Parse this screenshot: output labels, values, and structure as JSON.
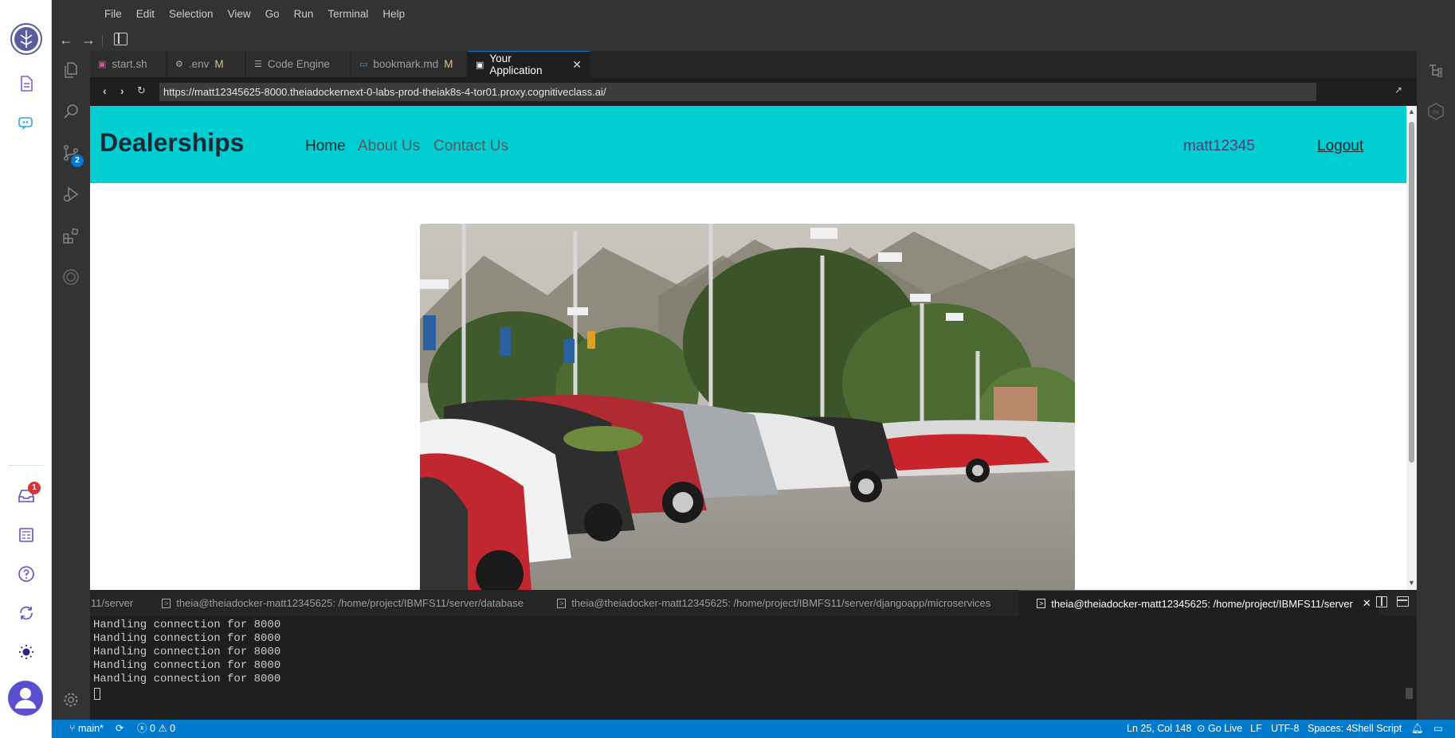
{
  "menu": [
    "File",
    "Edit",
    "Selection",
    "View",
    "Go",
    "Run",
    "Terminal",
    "Help"
  ],
  "outer_rail": {
    "inbox_badge": "1"
  },
  "activity": {
    "scm_badge": "2"
  },
  "tabs": [
    {
      "label": "start.sh",
      "modified": ""
    },
    {
      "label": ".env",
      "modified": "M"
    },
    {
      "label": "Code Engine",
      "modified": ""
    },
    {
      "label": "bookmark.md",
      "modified": "M"
    },
    {
      "label": "Your Application",
      "modified": ""
    }
  ],
  "browser": {
    "url": "https://matt12345625-8000.theiadockernext-0-labs-prod-theiak8s-4-tor01.proxy.cognitiveclass.ai/"
  },
  "site": {
    "brand": "Dealerships",
    "nav": [
      "Home",
      "About Us",
      "Contact Us"
    ],
    "username": "matt12345",
    "logout": "Logout",
    "header_color": "#00ced1"
  },
  "terminal": {
    "tabs": [
      "11/server",
      "theia@theiadocker-matt12345625: /home/project/IBMFS11/server/database",
      "theia@theiadocker-matt12345625: /home/project/IBMFS11/server/djangoapp/microservices",
      "theia@theiadocker-matt12345625: /home/project/IBMFS11/server"
    ],
    "lines": [
      "Handling connection for 8000",
      "Handling connection for 8000",
      "Handling connection for 8000",
      "Handling connection for 8000",
      "Handling connection for 8000"
    ]
  },
  "status": {
    "branch": "main*",
    "errors": "0",
    "warnings": "0",
    "position": "Ln 25, Col 148",
    "golive": "Go Live",
    "eol": "LF",
    "encoding": "UTF-8",
    "spaces": "Spaces: 4",
    "language": "Shell Script",
    "accent": "#007acc"
  }
}
